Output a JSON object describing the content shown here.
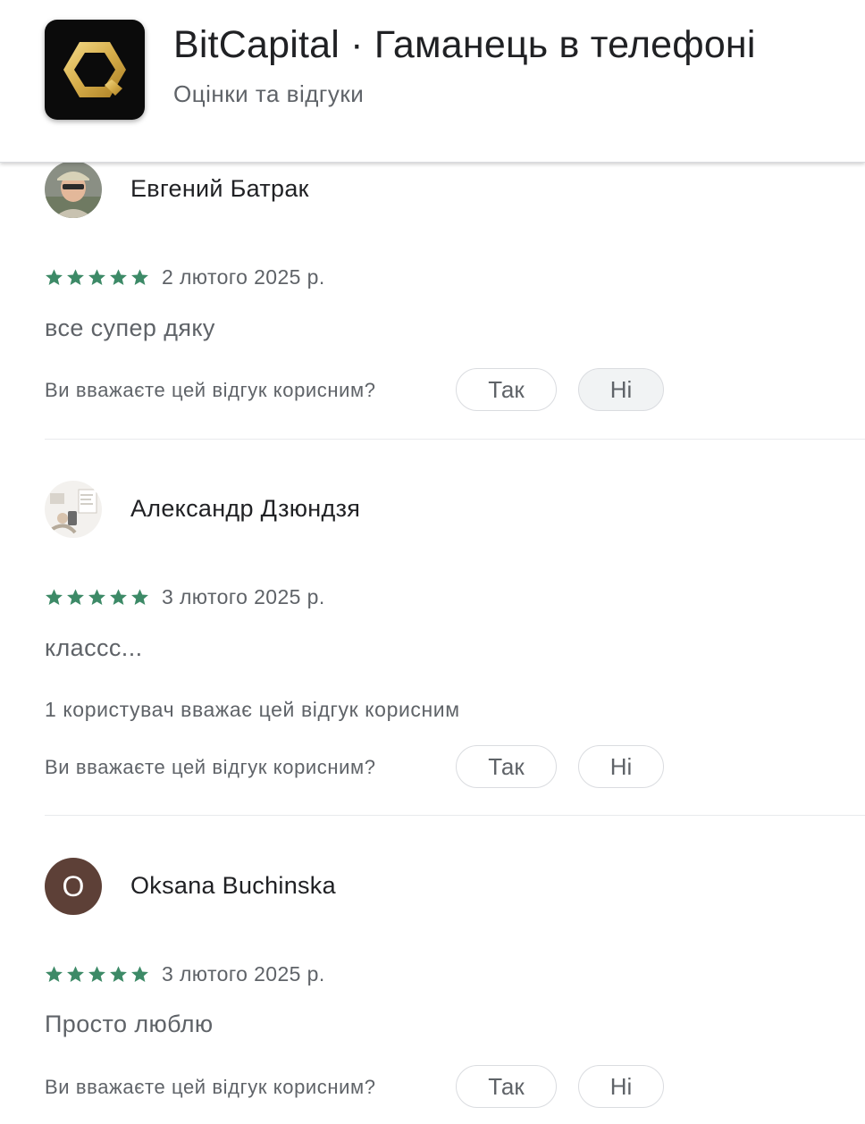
{
  "header": {
    "app_title": "BitCapital · Гаманець в телефоні",
    "subtitle": "Оцінки та відгуки",
    "app_icon": "bitcapital-logo-icon"
  },
  "colors": {
    "star": "#3d8a67",
    "accent": "#01875f",
    "avatar_letter_bg": "#5d4037"
  },
  "helpful_question": "Ви вважаєте цей відгук корисним?",
  "yes_label": "Так",
  "no_label": "Ні",
  "reviews": [
    {
      "name": "Евгений Батрак",
      "rating": 5,
      "date": "2 лютого 2025 р.",
      "text": "все супер дяку",
      "helpful_count_text": null
    },
    {
      "name": "Александр Дзюндзя",
      "rating": 5,
      "date": "3 лютого 2025 р.",
      "text": "классс...",
      "helpful_count_text": "1 користувач вважає цей відгук корисним"
    },
    {
      "name": "Oksana Buchinska",
      "avatar_letter": "O",
      "rating": 5,
      "date": "3 лютого 2025 р.",
      "text": "Просто люблю",
      "helpful_count_text": null
    }
  ]
}
